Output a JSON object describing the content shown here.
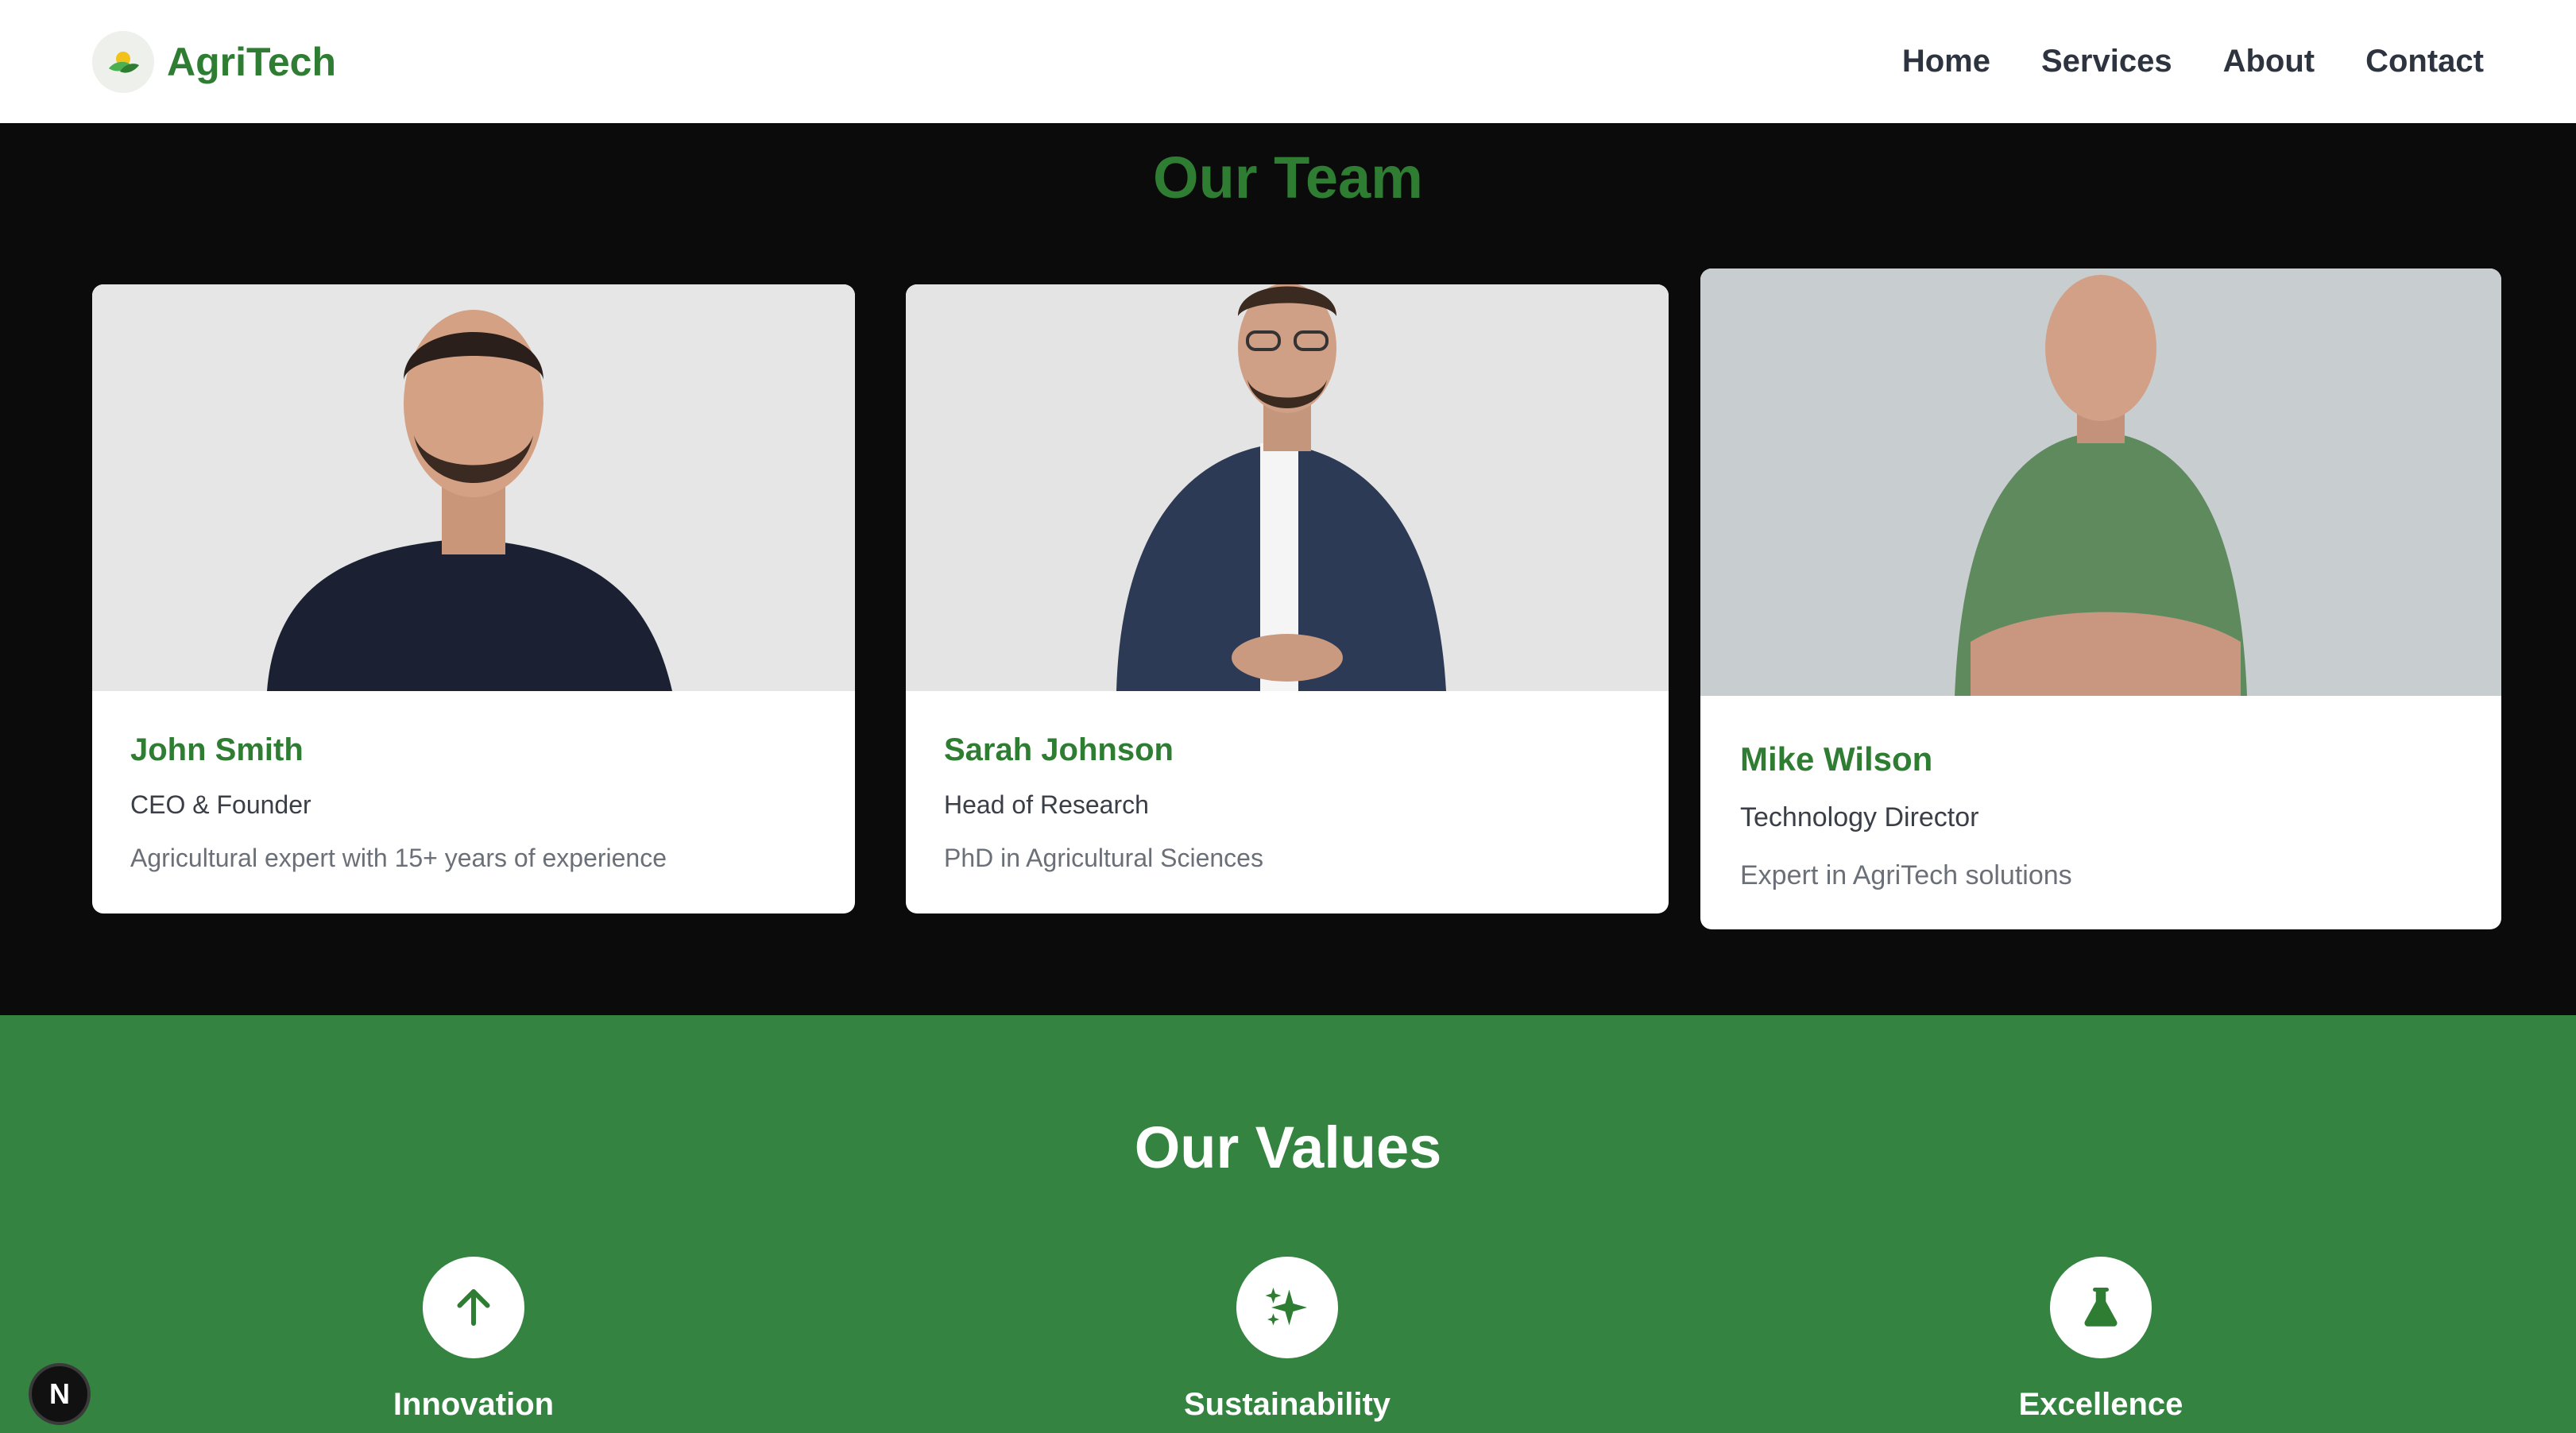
{
  "header": {
    "brand": "AgriTech",
    "logo_icon": "leaf-sun-logo",
    "nav": [
      {
        "label": "Home"
      },
      {
        "label": "Services"
      },
      {
        "label": "About"
      },
      {
        "label": "Contact"
      }
    ]
  },
  "team": {
    "title": "Our Team",
    "members": [
      {
        "name": "John Smith",
        "role": "CEO & Founder",
        "description": "Agricultural expert with 15+ years of experience"
      },
      {
        "name": "Sarah Johnson",
        "role": "Head of Research",
        "description": "PhD in Agricultural Sciences"
      },
      {
        "name": "Mike Wilson",
        "role": "Technology Director",
        "description": "Expert in AgriTech solutions"
      }
    ]
  },
  "values": {
    "title": "Our Values",
    "items": [
      {
        "label": "Innovation",
        "icon": "arrow-up-icon"
      },
      {
        "label": "Sustainability",
        "icon": "sparkles-icon"
      },
      {
        "label": "Excellence",
        "icon": "flask-icon"
      }
    ]
  },
  "badge": {
    "text": "N"
  },
  "colors": {
    "brand_green": "#2e7d32",
    "values_bg": "#358340",
    "team_bg": "#0b0b0b"
  }
}
